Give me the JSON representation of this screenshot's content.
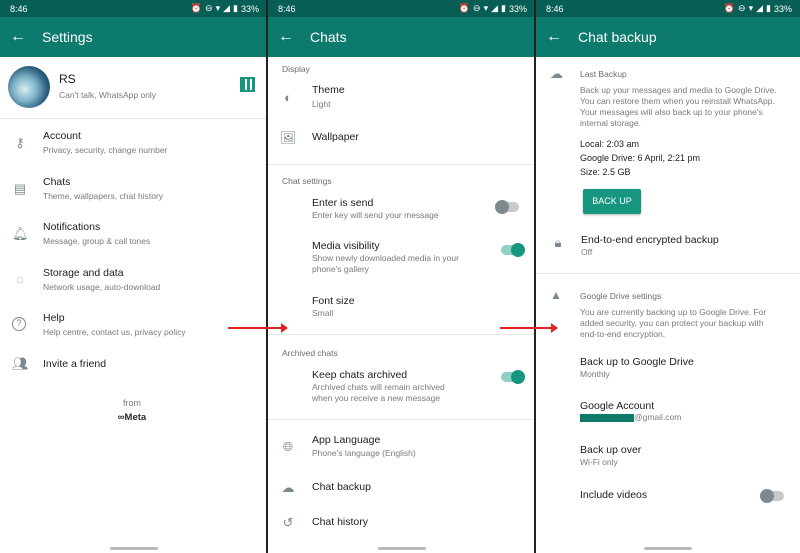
{
  "status": {
    "time": "8:46",
    "battery": "33%"
  },
  "settings": {
    "title": "Settings",
    "profile": {
      "name": "RS",
      "status": "Can't talk, WhatsApp only"
    },
    "items": [
      {
        "label": "Account",
        "sub": "Privacy, security, change number",
        "icon": "key-icon"
      },
      {
        "label": "Chats",
        "sub": "Theme, wallpapers, chat history",
        "icon": "chat-icon"
      },
      {
        "label": "Notifications",
        "sub": "Message, group & call tones",
        "icon": "bell-icon"
      },
      {
        "label": "Storage and data",
        "sub": "Network usage, auto-download",
        "icon": "storage-icon"
      },
      {
        "label": "Help",
        "sub": "Help centre, contact us, privacy policy",
        "icon": "help-icon"
      },
      {
        "label": "Invite a friend",
        "sub": "",
        "icon": "people-icon"
      }
    ],
    "from": "from",
    "brand": "∞Meta"
  },
  "chats": {
    "title": "Chats",
    "display_head": "Display",
    "theme": {
      "label": "Theme",
      "sub": "Light"
    },
    "wallpaper": {
      "label": "Wallpaper"
    },
    "chat_settings_head": "Chat settings",
    "enter_send": {
      "label": "Enter is send",
      "sub": "Enter key will send your message",
      "on": false
    },
    "media_visibility": {
      "label": "Media visibility",
      "sub1": "Show newly downloaded media in your",
      "sub2": "phone's gallery",
      "on": true
    },
    "font_size": {
      "label": "Font size",
      "sub": "Small"
    },
    "archived_head": "Archived chats",
    "keep_archived": {
      "label": "Keep chats archived",
      "sub1": "Archived chats will remain archived",
      "sub2": "when you receive a new message",
      "on": true
    },
    "app_language": {
      "label": "App Language",
      "sub": "Phone's language (English)"
    },
    "chat_backup": {
      "label": "Chat backup"
    },
    "chat_history": {
      "label": "Chat history"
    }
  },
  "backup": {
    "title": "Chat backup",
    "last_backup_head": "Last Backup",
    "desc1": "Back up your messages and media to Google Drive.",
    "desc2": "You can restore them when you reinstall WhatsApp.",
    "desc3": "Your messages will also back up to your phone's",
    "desc4": "internal storage.",
    "local": "Local: 2:03 am",
    "gdrive": "Google Drive: 6 April, 2:21 pm",
    "size": "Size: 2.5 GB",
    "backup_button": "BACK UP",
    "e2e": {
      "label": "End-to-end encrypted backup",
      "sub": "Off"
    },
    "gd_settings_head": "Google Drive settings",
    "gd_desc1": "You are currently backing up to Google Drive. For",
    "gd_desc2": "added security, you can protect your backup with",
    "gd_desc3": "end-to-end encryption.",
    "backup_to_gd": {
      "label": "Back up to Google Drive",
      "sub": "Monthly"
    },
    "google_account": {
      "label": "Google Account",
      "sub": "@gmail.com"
    },
    "backup_over": {
      "label": "Back up over",
      "sub": "Wi-Fi only"
    },
    "include_videos": {
      "label": "Include videos",
      "on": false
    }
  },
  "colors": {
    "header": "#0c7a6c",
    "statusbar": "#075e54",
    "accent": "#17967f",
    "arrow": "#e02424"
  }
}
